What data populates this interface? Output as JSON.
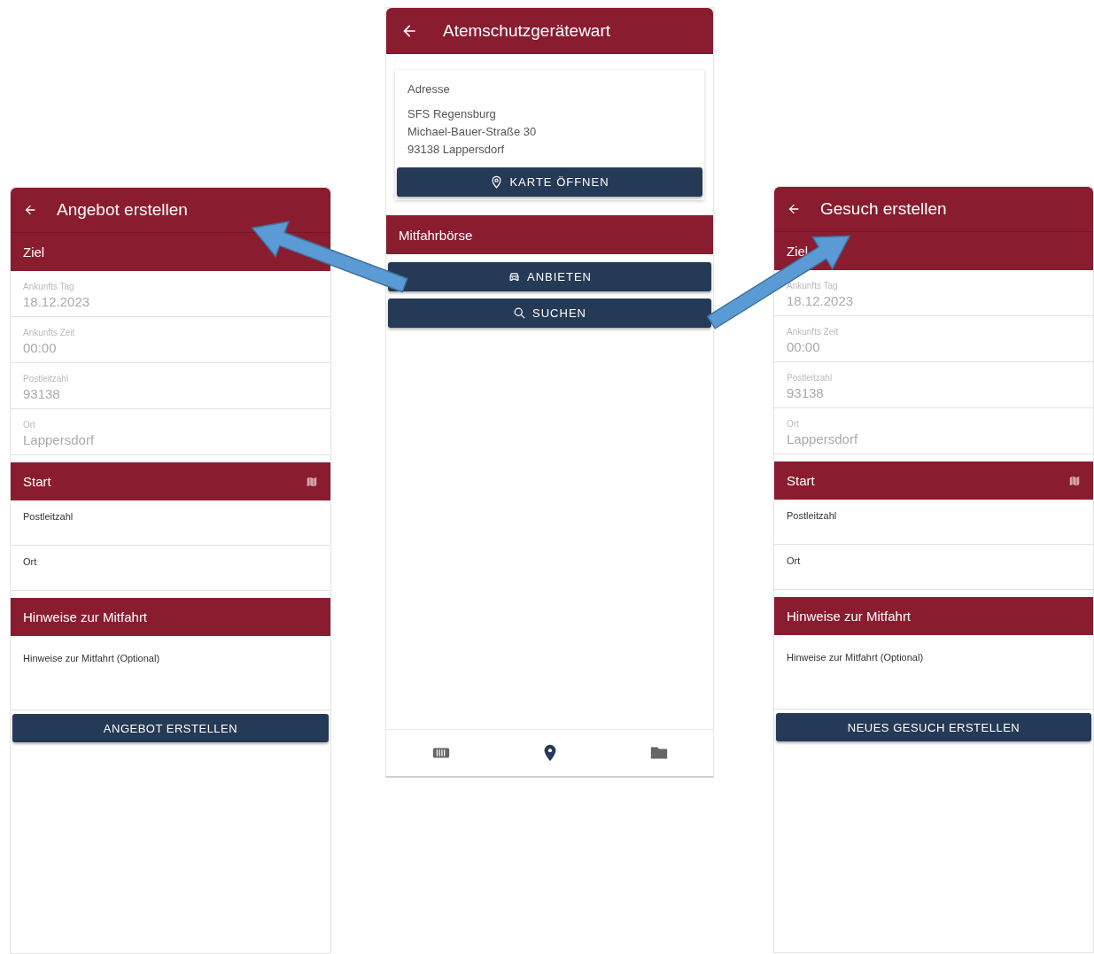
{
  "left_screen": {
    "title": "Angebot erstellen",
    "sections": [
      {
        "title": "Ziel",
        "map_icon": false,
        "fields": [
          {
            "label": "Ankunfts Tag",
            "value": "18.12.2023",
            "disabled": true
          },
          {
            "label": "Ankunfts Zeit",
            "value": "00:00",
            "disabled": true
          },
          {
            "label": "Postleitzahl",
            "value": "93138",
            "disabled": true
          },
          {
            "label": "Ort",
            "value": "Lappersdorf",
            "disabled": true
          }
        ]
      },
      {
        "title": "Start",
        "map_icon": true,
        "fields": [
          {
            "placeholder": "Postleitzahl"
          },
          {
            "placeholder": "Ort"
          }
        ]
      },
      {
        "title": "Hinweise zur Mitfahrt",
        "map_icon": false,
        "fields": [
          {
            "placeholder": "Hinweise zur Mitfahrt (Optional)",
            "multiline": true
          }
        ]
      }
    ],
    "submit": "ANGEBOT ERSTELLEN"
  },
  "center_screen": {
    "title": "Atemschutzgerätewart",
    "address": {
      "label": "Adresse",
      "lines": [
        "SFS Regensburg",
        "Michael-Bauer-Straße 30",
        "93138 Lappersdorf"
      ],
      "button": "KARTE ÖFFNEN"
    },
    "section": "Mitfahrbörse",
    "actions": [
      "ANBIETEN",
      "SUCHEN"
    ],
    "bottom_nav": [
      {
        "selected": false
      },
      {
        "selected": true
      },
      {
        "selected": false
      }
    ]
  },
  "right_screen": {
    "title": "Gesuch erstellen",
    "sections": [
      {
        "title": "Ziel",
        "map_icon": false,
        "fields": [
          {
            "label": "Ankunfts Tag",
            "value": "18.12.2023",
            "disabled": true
          },
          {
            "label": "Ankunfts Zeit",
            "value": "00:00",
            "disabled": true
          },
          {
            "label": "Postleitzahl",
            "value": "93138",
            "disabled": true
          },
          {
            "label": "Ort",
            "value": "Lappersdorf",
            "disabled": true
          }
        ]
      },
      {
        "title": "Start",
        "map_icon": true,
        "fields": [
          {
            "placeholder": "Postleitzahl"
          },
          {
            "placeholder": "Ort"
          }
        ]
      },
      {
        "title": "Hinweise zur Mitfahrt",
        "map_icon": false,
        "fields": [
          {
            "placeholder": "Hinweise zur Mitfahrt (Optional)",
            "multiline": true
          }
        ]
      }
    ],
    "submit": "NEUES GESUCH ERSTELLEN"
  }
}
